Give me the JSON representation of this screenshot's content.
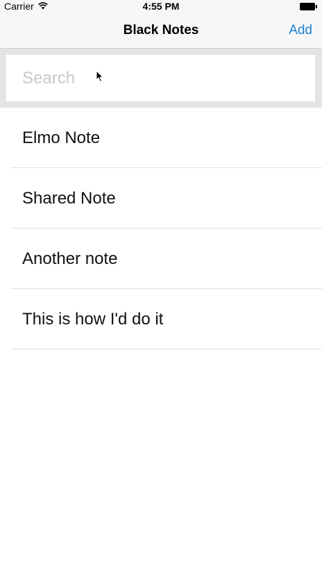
{
  "status_bar": {
    "carrier": "Carrier",
    "time": "4:55 PM",
    "wifi_icon": "wifi-icon",
    "battery_icon": "battery-icon"
  },
  "nav": {
    "title": "Black Notes",
    "add_label": "Add",
    "accent_color": "#1a7fd6"
  },
  "search": {
    "placeholder": "Search",
    "value": ""
  },
  "notes": [
    {
      "title": "Elmo Note"
    },
    {
      "title": "Shared Note"
    },
    {
      "title": "Another note"
    },
    {
      "title": "This is how I'd do it"
    }
  ]
}
